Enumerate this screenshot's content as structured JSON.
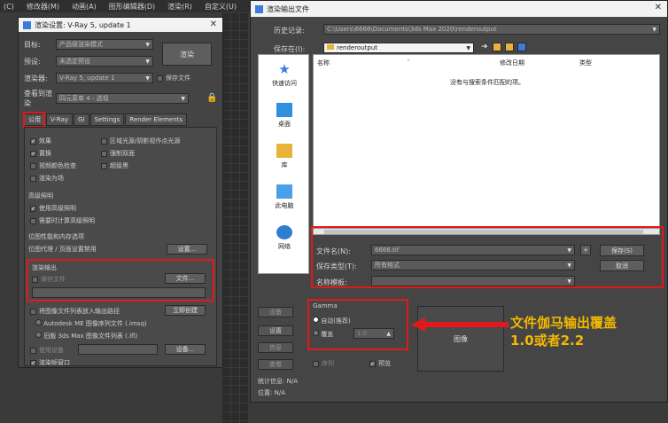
{
  "menu": [
    "(C)",
    "修改器(M)",
    "动画(A)",
    "图形编辑器(D)",
    "渲染(R)",
    "自定义(U)"
  ],
  "render_setup": {
    "title": "渲染设置: V-Ray 5, update 1",
    "target_label": "目标:",
    "target_value": "产品级渲染模式",
    "preset_label": "预设:",
    "preset_value": "未选定预设",
    "renderer_label": "渲染器:",
    "renderer_value": "V-Ray 5, update 1",
    "save_file_label": "保存文件",
    "view_label_1": "查看到渲",
    "view_label_2": "染",
    "view_value": "四元菜单 4 - 透视",
    "render_button": "渲染",
    "tabs": [
      "公用",
      "V-Ray",
      "GI",
      "Settings",
      "Render Elements"
    ],
    "opts_left": [
      "效果",
      "置换",
      "视频颜色检查",
      "渲染为场"
    ],
    "opts_right": [
      "区域光源/阴影视作点光源",
      "强制双面",
      "超级黑"
    ],
    "advanced_lighting": "高级照明",
    "use_advanced": "使用高级照明",
    "compute_advanced": "需要时计算高级照明",
    "bitmap_perf": "位图性能和内存选项",
    "bitmap_proxy": "位图代理 / 页面设置禁用",
    "setup_button": "设置...",
    "render_output": "渲染输出",
    "save_file": "保存文件",
    "files_button": "文件...",
    "put_image_list": "将图像文件列表放入输出路径",
    "create_now": "立即创建",
    "autodesk_seq": "Autodesk ME 图像序列文件 (.imsq)",
    "legacy_seq": "旧版 3ds Max 图像文件列表 (.ifl)",
    "use_device": "使用设备",
    "device_button": "设备...",
    "render_frame_window": "渲染帧窗口"
  },
  "file_dialog": {
    "title": "渲染输出文件",
    "history_label": "历史记录:",
    "history_value": "C:\\Users\\6666\\Documents\\3ds Max 2020\\renderoutput",
    "save_in_label": "保存在(I):",
    "save_in_value": "renderoutput",
    "places": [
      "快速访问",
      "桌面",
      "库",
      "此电脑",
      "网络"
    ],
    "columns": [
      "名称",
      "修改日期",
      "类型"
    ],
    "empty_message": "没有与搜索条件匹配的项。",
    "filename_label": "文件名(N):",
    "filename_value": "6666.tif",
    "filetype_label": "保存类型(T):",
    "filetype_value": "所有格式",
    "template_label": "名称模板:",
    "save_button": "保存(S)",
    "cancel_button": "取消",
    "gamma_title": "Gamma",
    "gamma_auto": "自动(推荐)",
    "gamma_override": "覆盖",
    "gamma_value": "1.0",
    "image_button": "图像",
    "left_buttons": [
      "设备",
      "设置",
      "信息",
      "查看"
    ],
    "sequence": "序列",
    "preview": "预览",
    "stats_label": "统计信息:",
    "stats_value": "N/A",
    "location_label": "位置:",
    "location_value": "N/A"
  },
  "annotation": [
    "文件伽马输出覆盖",
    "1.0或者2.2"
  ],
  "colors": {
    "highlight": "#e01a1a",
    "annotation": "#f2b800",
    "accent": "#3c7bd8"
  }
}
